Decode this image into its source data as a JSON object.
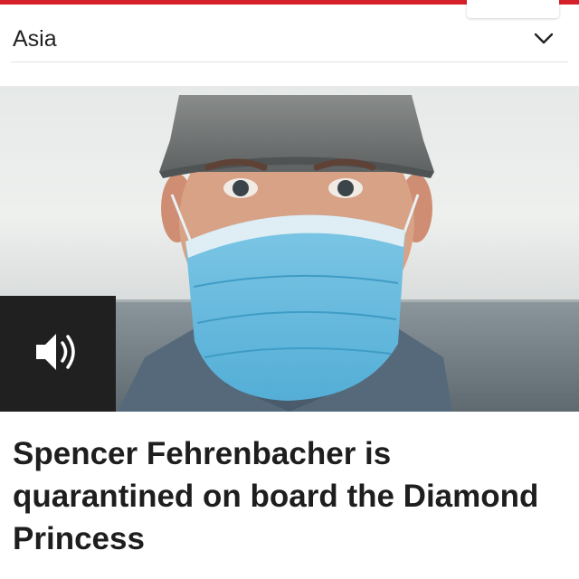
{
  "header": {
    "section_title": "Asia",
    "dropdown_icon": "chevron-down-icon"
  },
  "media": {
    "audio_icon": "speaker-volume-icon"
  },
  "article": {
    "headline": "Spencer Fehrenbacher is quarantined on board the Diamond Princess"
  },
  "colors": {
    "accent": "#d6202a",
    "headline_text": "#1e1e1e",
    "audio_button_bg": "#202020",
    "divider": "#e2e2e2"
  }
}
